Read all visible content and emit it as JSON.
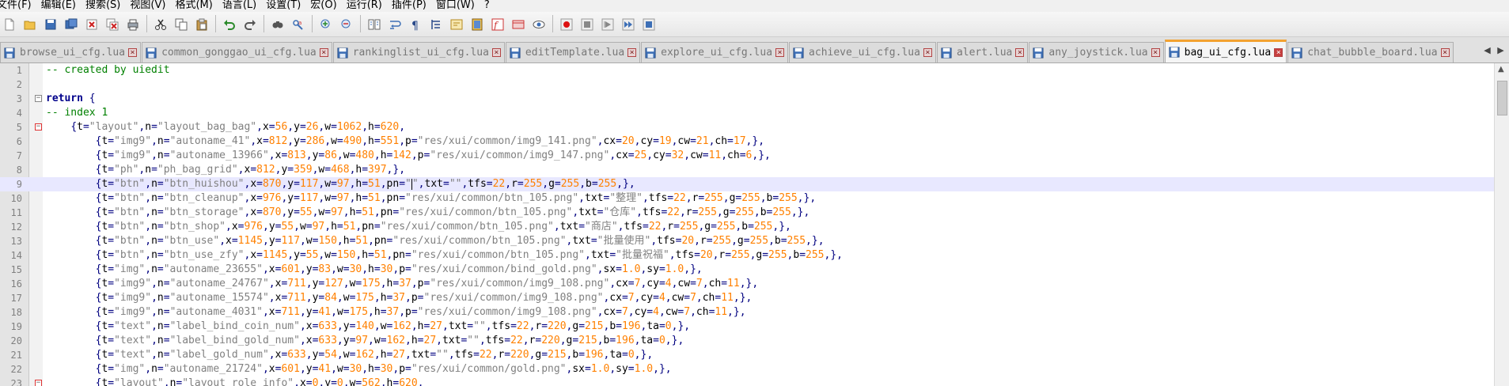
{
  "menu": [
    "文件(F)",
    "编辑(E)",
    "搜索(S)",
    "视图(V)",
    "格式(M)",
    "语言(L)",
    "设置(T)",
    "宏(O)",
    "运行(R)",
    "插件(P)",
    "窗口(W)",
    "?"
  ],
  "toolbar": {
    "groups": [
      [
        "new-file-icon",
        "open-file-icon",
        "save-icon",
        "save-all-icon",
        "close-icon",
        "close-all-icon",
        "print-icon"
      ],
      [
        "cut-icon",
        "copy-icon",
        "paste-icon"
      ],
      [
        "undo-icon",
        "redo-icon"
      ],
      [
        "find-icon",
        "replace-icon"
      ],
      [
        "zoom-in-icon",
        "zoom-out-icon"
      ],
      [
        "sync-scroll-icon",
        "word-wrap-icon",
        "show-all-chars-icon",
        "indent-guide-icon",
        "user-lang-icon",
        "doc-map-icon",
        "function-list-icon",
        "folder-workspace-icon",
        "monitor-icon"
      ],
      [
        "record-macro-icon",
        "stop-record-icon",
        "play-macro-icon",
        "run-macro-multiple-icon",
        "save-macro-icon"
      ]
    ]
  },
  "tabs": [
    {
      "label": "browse_ui_cfg.lua",
      "active": false
    },
    {
      "label": "common_gonggao_ui_cfg.lua",
      "active": false
    },
    {
      "label": "rankinglist_ui_cfg.lua",
      "active": false
    },
    {
      "label": "editTemplate.lua",
      "active": false
    },
    {
      "label": "explore_ui_cfg.lua",
      "active": false
    },
    {
      "label": "achieve_ui_cfg.lua",
      "active": false
    },
    {
      "label": "alert.lua",
      "active": false
    },
    {
      "label": "any_joystick.lua",
      "active": false
    },
    {
      "label": "bag_ui_cfg.lua",
      "active": true
    },
    {
      "label": "chat_bubble_board.lua",
      "active": false
    }
  ],
  "editor": {
    "current_line": 9,
    "lines": [
      {
        "n": "1",
        "text": "-- created by uiedit"
      },
      {
        "n": "2",
        "text": ""
      },
      {
        "n": "3",
        "text": "return {",
        "fold": "box"
      },
      {
        "n": "4",
        "text": "-- index 1"
      },
      {
        "n": "5",
        "text": "    {t=\"layout\",n=\"layout_bag_bag\",x=56,y=26,w=1062,h=620,",
        "fold": "red"
      },
      {
        "n": "6",
        "text": "        {t=\"img9\",n=\"autoname_41\",x=812,y=286,w=490,h=551,p=\"res/xui/common/img9_141.png\",cx=20,cy=19,cw=21,ch=17,},"
      },
      {
        "n": "7",
        "text": "        {t=\"img9\",n=\"autoname_13966\",x=813,y=86,w=480,h=142,p=\"res/xui/common/img9_147.png\",cx=25,cy=32,cw=11,ch=6,},"
      },
      {
        "n": "8",
        "text": "        {t=\"ph\",n=\"ph_bag_grid\",x=812,y=359,w=468,h=397,},"
      },
      {
        "n": "9",
        "text": "        {t=\"btn\",n=\"btn_huishou\",x=870,y=117,w=97,h=51,pn=\"\",txt=\"\",tfs=22,r=255,g=255,b=255,},"
      },
      {
        "n": "10",
        "text": "        {t=\"btn\",n=\"btn_cleanup\",x=976,y=117,w=97,h=51,pn=\"res/xui/common/btn_105.png\",txt=\"整理\",tfs=22,r=255,g=255,b=255,},"
      },
      {
        "n": "11",
        "text": "        {t=\"btn\",n=\"btn_storage\",x=870,y=55,w=97,h=51,pn=\"res/xui/common/btn_105.png\",txt=\"仓库\",tfs=22,r=255,g=255,b=255,},"
      },
      {
        "n": "12",
        "text": "        {t=\"btn\",n=\"btn_shop\",x=976,y=55,w=97,h=51,pn=\"res/xui/common/btn_105.png\",txt=\"商店\",tfs=22,r=255,g=255,b=255,},"
      },
      {
        "n": "13",
        "text": "        {t=\"btn\",n=\"btn_use\",x=1145,y=117,w=150,h=51,pn=\"res/xui/common/btn_105.png\",txt=\"批量使用\",tfs=20,r=255,g=255,b=255,},"
      },
      {
        "n": "14",
        "text": "        {t=\"btn\",n=\"btn_use_zfy\",x=1145,y=55,w=150,h=51,pn=\"res/xui/common/btn_105.png\",txt=\"批量祝福\",tfs=20,r=255,g=255,b=255,},"
      },
      {
        "n": "15",
        "text": "        {t=\"img\",n=\"autoname_23655\",x=601,y=83,w=30,h=30,p=\"res/xui/common/bind_gold.png\",sx=1.0,sy=1.0,},"
      },
      {
        "n": "16",
        "text": "        {t=\"img9\",n=\"autoname_24767\",x=711,y=127,w=175,h=37,p=\"res/xui/common/img9_108.png\",cx=7,cy=4,cw=7,ch=11,},"
      },
      {
        "n": "17",
        "text": "        {t=\"img9\",n=\"autoname_15574\",x=711,y=84,w=175,h=37,p=\"res/xui/common/img9_108.png\",cx=7,cy=4,cw=7,ch=11,},"
      },
      {
        "n": "18",
        "text": "        {t=\"img9\",n=\"autoname_4031\",x=711,y=41,w=175,h=37,p=\"res/xui/common/img9_108.png\",cx=7,cy=4,cw=7,ch=11,},"
      },
      {
        "n": "19",
        "text": "        {t=\"text\",n=\"label_bind_coin_num\",x=633,y=140,w=162,h=27,txt=\"\",tfs=22,r=220,g=215,b=196,ta=0,},"
      },
      {
        "n": "20",
        "text": "        {t=\"text\",n=\"label_bind_gold_num\",x=633,y=97,w=162,h=27,txt=\"\",tfs=22,r=220,g=215,b=196,ta=0,},"
      },
      {
        "n": "21",
        "text": "        {t=\"text\",n=\"label_gold_num\",x=633,y=54,w=162,h=27,txt=\"\",tfs=22,r=220,g=215,b=196,ta=0,},"
      },
      {
        "n": "22",
        "text": "        {t=\"img\",n=\"autoname_21724\",x=601,y=41,w=30,h=30,p=\"res/xui/common/gold.png\",sx=1.0,sy=1.0,},"
      },
      {
        "n": "23",
        "text": "        {t=\"layout\",n=\"layout_role_info\",x=0,y=0,w=562,h=620,",
        "fold": "red"
      }
    ]
  }
}
